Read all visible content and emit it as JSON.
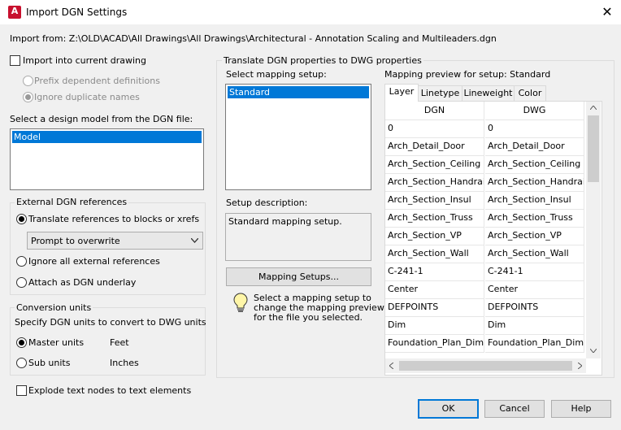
{
  "window": {
    "title": "Import DGN Settings",
    "app_icon_letter": "A",
    "close_glyph": "✕"
  },
  "import_from": "Import from: Z:\\OLD\\ACAD\\All Drawings\\All Drawings\\Architectural - Annotation Scaling and Multileaders.dgn",
  "left": {
    "import_current": "Import into current drawing",
    "prefix_defs": "Prefix dependent definitions",
    "ignore_dups": "Ignore duplicate names",
    "design_model_label": "Select a design model from the DGN file:",
    "models": [
      "Model"
    ],
    "ext_refs": {
      "title": "External DGN references",
      "translate": "Translate references to blocks or xrefs",
      "combo_value": "Prompt to overwrite",
      "ignore_all": "Ignore all external references",
      "attach": "Attach as DGN underlay"
    },
    "conversion": {
      "title": "Conversion units",
      "desc": "Specify DGN units to convert to DWG units",
      "master": "Master units",
      "master_val": "Feet",
      "sub": "Sub units",
      "sub_val": "Inches"
    },
    "explode": "Explode text nodes to text elements"
  },
  "translate": {
    "title": "Translate DGN properties to DWG properties",
    "select_setup_label": "Select mapping setup:",
    "setups": [
      "Standard"
    ],
    "setup_desc_label": "Setup description:",
    "setup_desc": "Standard mapping setup.",
    "mapping_setups_btn": "Mapping Setups...",
    "hint": [
      "Select a mapping setup to",
      "change the mapping preview",
      "for the file you selected."
    ],
    "preview_label": "Mapping preview for setup: Standard",
    "tabs": [
      "Layer",
      "Linetype",
      "Lineweight",
      "Color"
    ],
    "columns": [
      "DGN",
      "DWG"
    ],
    "rows": [
      [
        "0",
        "0"
      ],
      [
        "Arch_Detail_Door",
        "Arch_Detail_Door"
      ],
      [
        "Arch_Section_Ceiling",
        "Arch_Section_Ceiling"
      ],
      [
        "Arch_Section_Handrail",
        "Arch_Section_Handrail"
      ],
      [
        "Arch_Section_Insul",
        "Arch_Section_Insul"
      ],
      [
        "Arch_Section_Truss",
        "Arch_Section_Truss"
      ],
      [
        "Arch_Section_VP",
        "Arch_Section_VP"
      ],
      [
        "Arch_Section_Wall",
        "Arch_Section_Wall"
      ],
      [
        "C-241-1",
        "C-241-1"
      ],
      [
        "Center",
        "Center"
      ],
      [
        "DEFPOINTS",
        "DEFPOINTS"
      ],
      [
        "Dim",
        "Dim"
      ],
      [
        "Foundation_Plan_Dim",
        "Foundation_Plan_Dim"
      ]
    ]
  },
  "buttons": {
    "ok": "OK",
    "cancel": "Cancel",
    "help": "Help"
  }
}
